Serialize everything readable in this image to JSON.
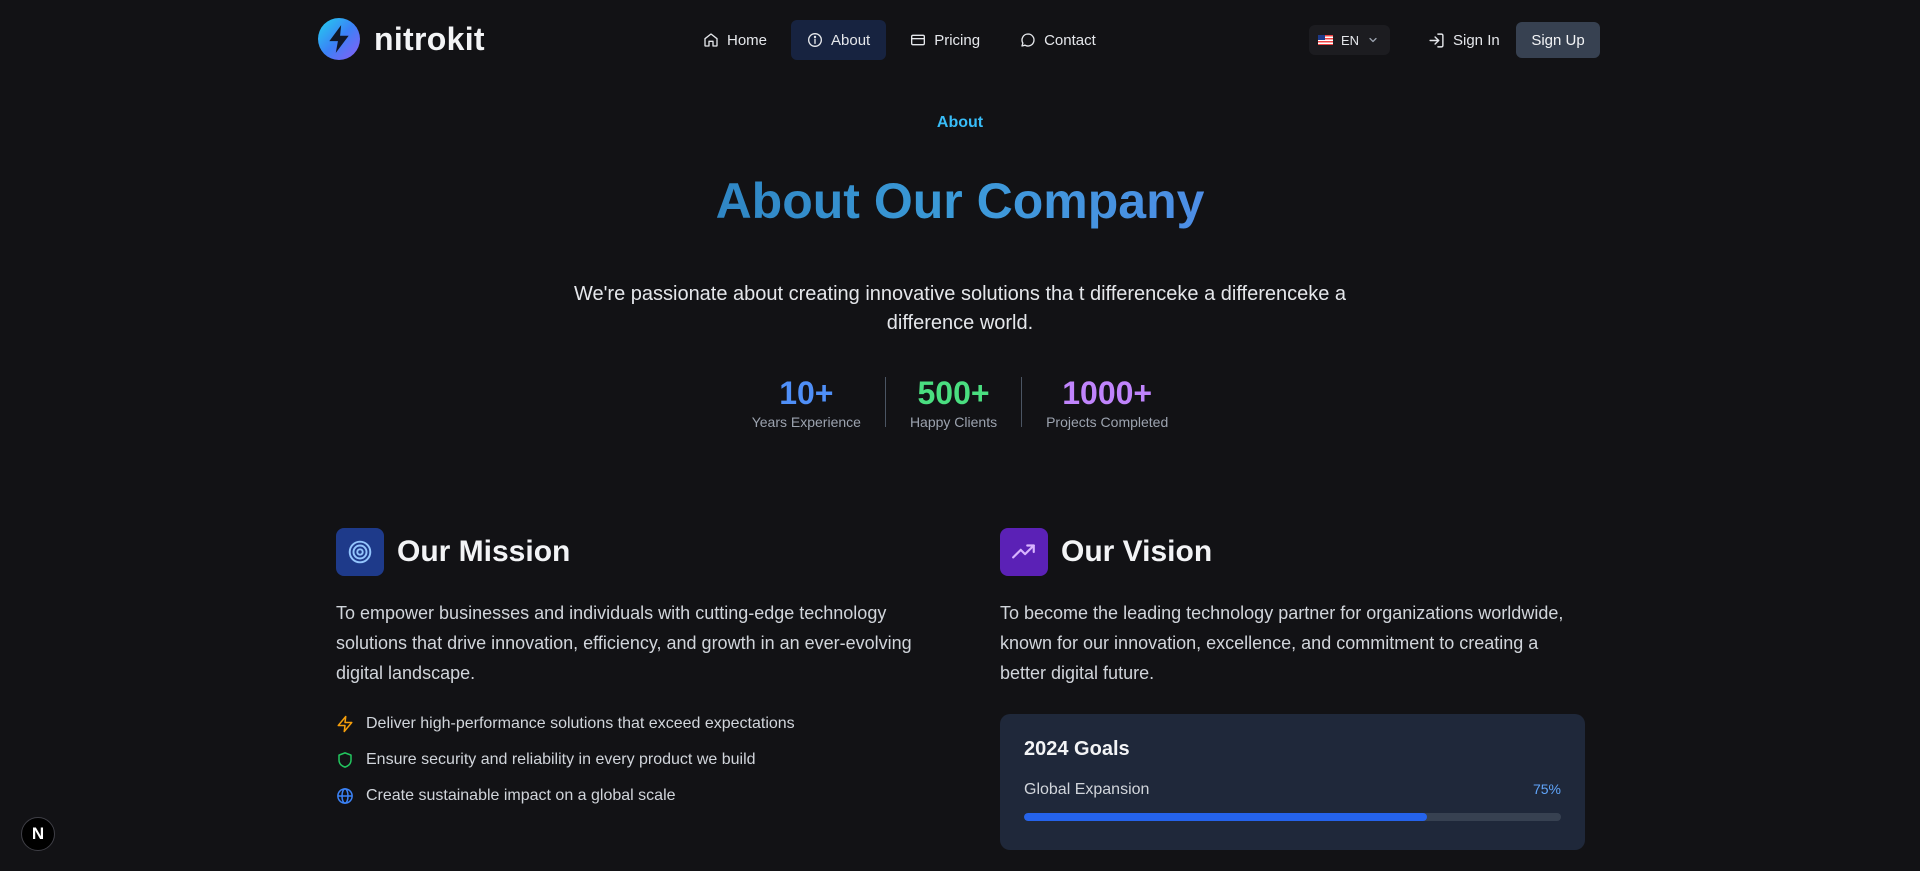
{
  "brand": {
    "name": "nitrokit"
  },
  "nav": {
    "items": [
      {
        "label": "Home",
        "icon": "home-icon"
      },
      {
        "label": "About",
        "icon": "info-icon",
        "active": true
      },
      {
        "label": "Pricing",
        "icon": "card-icon"
      },
      {
        "label": "Contact",
        "icon": "chat-icon"
      }
    ]
  },
  "header": {
    "lang": "EN",
    "sign_in": "Sign In",
    "sign_up": "Sign Up"
  },
  "hero": {
    "eyebrow": "About",
    "title": "About Our Company",
    "subtitle": "We're passionate about creating innovative solutions tha t differenceke a differenceke a difference world."
  },
  "stats": [
    {
      "value": "10+",
      "label": "Years Experience",
      "color": "#4f8ff7"
    },
    {
      "value": "500+",
      "label": "Happy Clients",
      "color": "#4ade80"
    },
    {
      "value": "1000+",
      "label": "Projects Completed",
      "color": "#c084fc"
    }
  ],
  "mission": {
    "title": "Our Mission",
    "icon": "target-icon",
    "text": "To empower businesses and individuals with cutting-edge technology solutions that drive innovation, efficiency, and growth in an ever-evolving digital landscape.",
    "bullets": [
      {
        "text": "Deliver high-performance solutions that exceed expectations",
        "icon": "lightning-icon",
        "color": "#f59e0b"
      },
      {
        "text": "Ensure security and reliability in every product we build",
        "icon": "shield-icon",
        "color": "#22c55e"
      },
      {
        "text": "Create sustainable impact on a global scale",
        "icon": "globe-icon",
        "color": "#3b82f6"
      }
    ]
  },
  "vision": {
    "title": "Our Vision",
    "icon": "trending-up-icon",
    "text": "To become the leading technology partner for organizations worldwide, known for our innovation, excellence, and commitment to creating a better digital future.",
    "goals": {
      "title": "2024 Goals",
      "items": [
        {
          "label": "Global Expansion",
          "percent_text": "75%",
          "progress": 0.75
        }
      ]
    }
  },
  "colors": {
    "bg": "#121215",
    "accent": "#2563eb",
    "mission_icon_bg": "#1e3a8a",
    "vision_icon_bg": "#5b21b6"
  },
  "dev_badge": "N"
}
